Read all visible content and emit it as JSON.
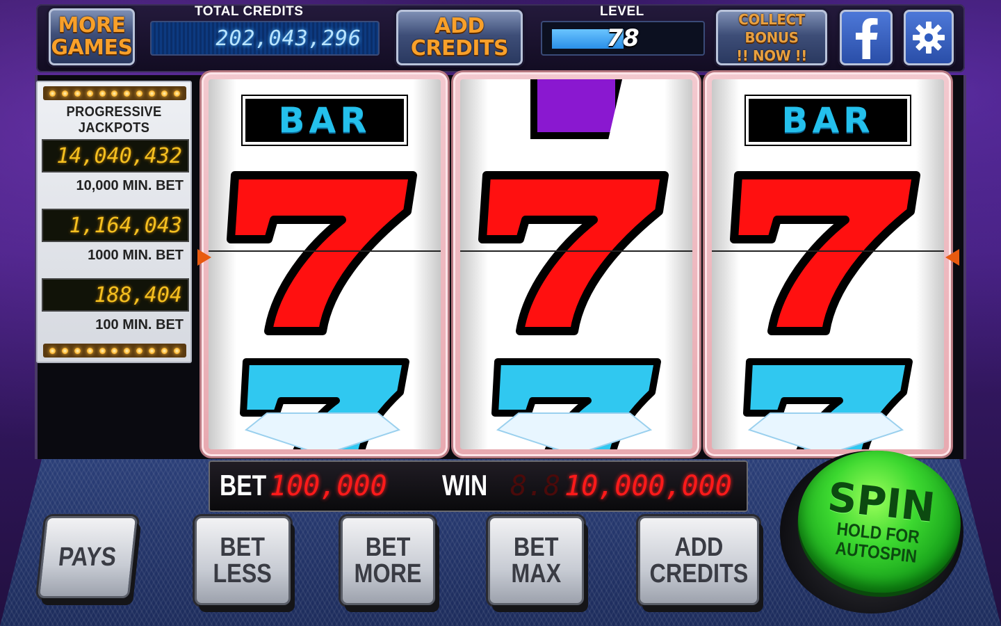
{
  "topbar": {
    "more_games": "MORE\nGAMES",
    "more_games_l1": "MORE",
    "more_games_l2": "GAMES",
    "total_credits_label": "TOTAL CREDITS",
    "total_credits_value": "202,043,296",
    "add_credits_l1": "ADD",
    "add_credits_l2": "CREDITS",
    "level_label": "LEVEL",
    "level_value": "78",
    "level_progress_fraction": 0.5,
    "collect_bonus_l1": "COLLECT BONUS",
    "collect_bonus_l2": "!! NOW !!",
    "facebook_icon": "facebook-icon",
    "settings_icon": "gear-icon"
  },
  "jackpots": {
    "title": "PROGRESSIVE JACKPOTS",
    "items": [
      {
        "value": "14,040,432",
        "min_bet": "10,000 MIN. BET"
      },
      {
        "value": "1,164,043",
        "min_bet": "1000 MIN. BET"
      },
      {
        "value": "188,404",
        "min_bet": "100 MIN. BET"
      }
    ]
  },
  "reels": [
    {
      "top": "BAR",
      "middle": "red-seven",
      "bottom": "blue-diamond-seven"
    },
    {
      "top": "purple-seven-partial",
      "middle": "red-seven",
      "bottom": "blue-diamond-seven"
    },
    {
      "top": "BAR",
      "middle": "red-seven",
      "bottom": "blue-diamond-seven"
    }
  ],
  "betwin": {
    "bet_label": "BET",
    "bet_value": "100,000",
    "win_label": "WIN",
    "win_ghost": "8.8",
    "win_value": "10,000,000"
  },
  "buttons": {
    "pays": "PAYS",
    "bet_less_l1": "BET",
    "bet_less_l2": "LESS",
    "bet_more_l1": "BET",
    "bet_more_l2": "MORE",
    "bet_max_l1": "BET",
    "bet_max_l2": "MAX",
    "add_credits_l1": "ADD",
    "add_credits_l2": "CREDITS",
    "spin": "SPIN",
    "spin_sub_l1": "HOLD FOR",
    "spin_sub_l2": "AUTOSPIN"
  },
  "colors": {
    "accent_orange": "#f8a02a",
    "jackpot_digits": "#f5c020",
    "bet_digits": "#ff1a1a",
    "spin_green": "#3cd830",
    "seven_red": "#ff1010",
    "bar_cyan": "#24c0ec"
  }
}
